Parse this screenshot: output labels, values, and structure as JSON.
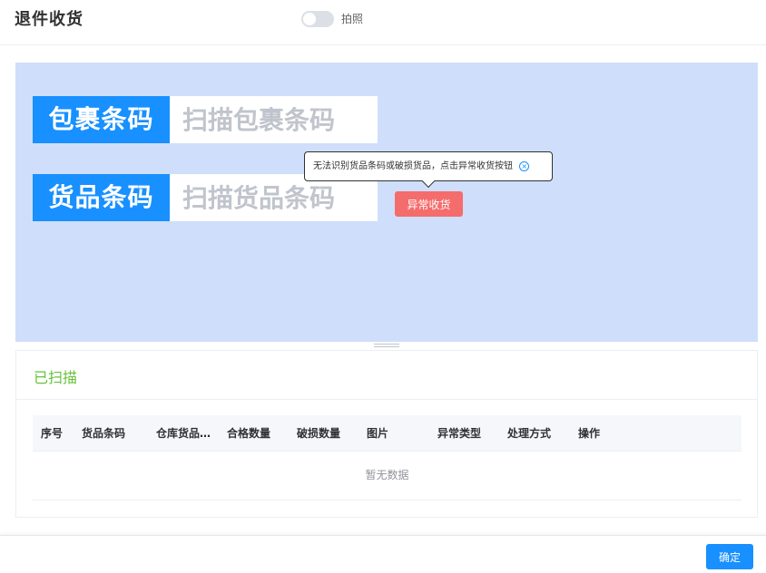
{
  "header": {
    "title": "退件收货",
    "photo_toggle": {
      "label": "拍照",
      "on": false
    }
  },
  "scan": {
    "package": {
      "label": "包裹条码",
      "placeholder": "扫描包裹条码",
      "value": ""
    },
    "goods": {
      "label": "货品条码",
      "placeholder": "扫描货品条码",
      "value": ""
    },
    "tooltip": {
      "text": "无法识别货品条码或破损货品，点击异常收货按钮",
      "close_icon": "close-circle-icon"
    },
    "abnormal_button": "异常收货"
  },
  "scanned": {
    "title": "已扫描",
    "columns": [
      "序号",
      "货品条码",
      "仓库货品…",
      "合格数量",
      "破损数量",
      "图片",
      "异常类型",
      "处理方式",
      "操作"
    ],
    "rows": [],
    "empty_text": "暂无数据"
  },
  "footer": {
    "confirm": "确定"
  },
  "colors": {
    "primary": "#1890ff",
    "danger": "#f56c6c",
    "success": "#67c23a",
    "scan_bg": "#cfdefa"
  }
}
